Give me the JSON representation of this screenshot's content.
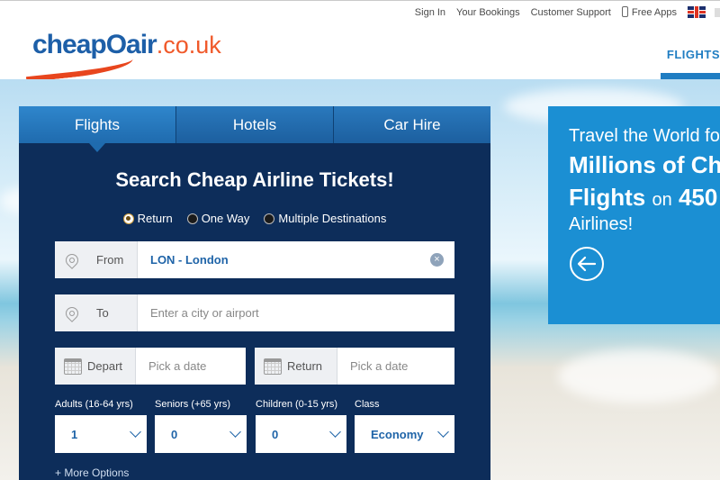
{
  "topnav": {
    "sign_in": "Sign In",
    "bookings": "Your Bookings",
    "support": "Customer Support",
    "apps": "Free Apps"
  },
  "logo": {
    "name": "cheapOair",
    "ext": ".co.uk"
  },
  "mainnav": {
    "flights": "FLIGHTS"
  },
  "tabs": [
    "Flights",
    "Hotels",
    "Car Hire"
  ],
  "search": {
    "title": "Search Cheap Airline Tickets!",
    "trip_types": [
      "Return",
      "One Way",
      "Multiple Destinations"
    ],
    "selected_trip": "Return",
    "from_label": "From",
    "from_value": "LON - London",
    "to_label": "To",
    "to_placeholder": "Enter a city or airport",
    "depart_label": "Depart",
    "depart_placeholder": "Pick a date",
    "return_label": "Return",
    "return_placeholder": "Pick a date",
    "pax": [
      {
        "label": "Adults (16-64 yrs)",
        "value": "1"
      },
      {
        "label": "Seniors (+65 yrs)",
        "value": "0"
      },
      {
        "label": "Children (0-15 yrs)",
        "value": "0"
      },
      {
        "label": "Class",
        "value": "Economy"
      }
    ],
    "more_options": "+ More Options"
  },
  "promo": {
    "line1": "Travel the World fo",
    "line2": "Millions of Ch",
    "line3_bold": "Flights",
    "line3_small": "on",
    "line3_num": "450",
    "line4": "Airlines!"
  },
  "colors": {
    "brand_blue": "#1f7dc2",
    "panel_navy": "#0d2d5a",
    "promo_blue": "#1b8fd3",
    "logo_orange": "#f0592a"
  }
}
